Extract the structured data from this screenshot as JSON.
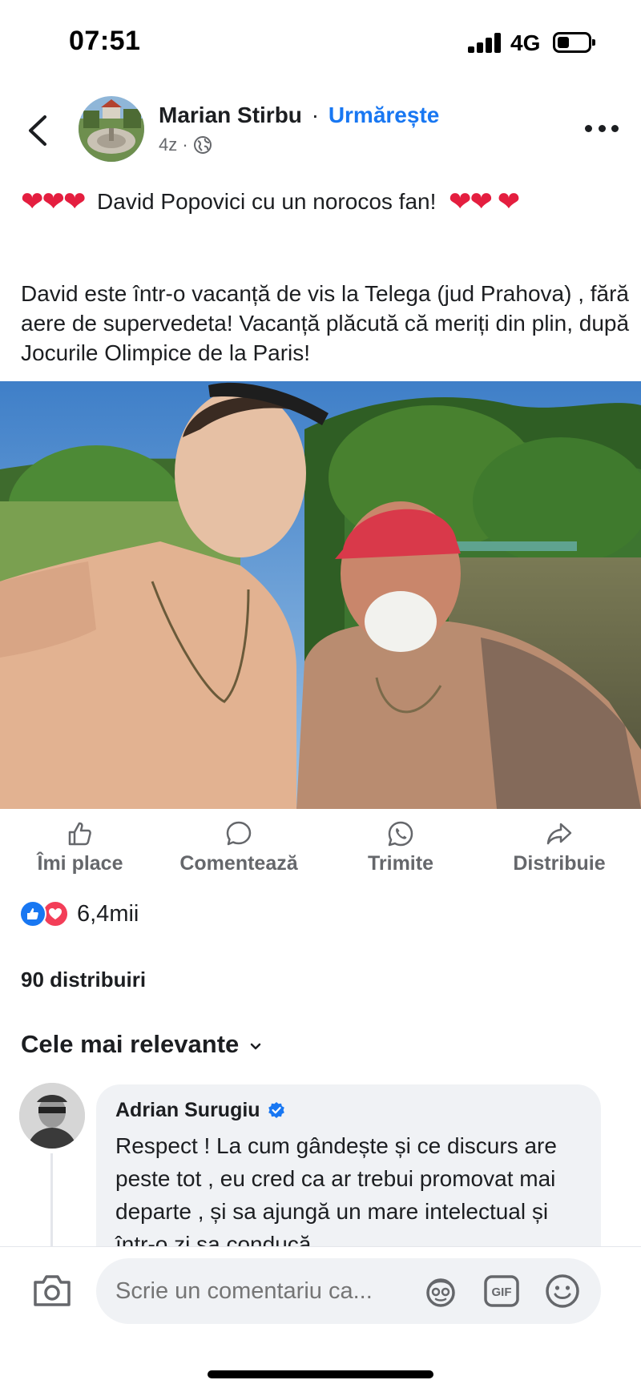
{
  "status_bar": {
    "time": "07:51",
    "network": "4G",
    "battery_level": 0.25
  },
  "post": {
    "author": "Marian Stirbu",
    "separator": "·",
    "follow_label": "Urmărește",
    "time_ago": "4z ·",
    "audience_icon": "globe-icon",
    "headline": "David Popovici cu un norocos fan!",
    "body": "David este într-o  vacanță de vis la Telega (jud Prahova) , fără aere de supervedeta! Vacanță plăcută că meriți din plin,  după Jocurile Olimpice de la Paris!"
  },
  "actions": {
    "like": "Îmi place",
    "comment": "Comentează",
    "send": "Trimite",
    "share": "Distribuie"
  },
  "stats": {
    "reactions_count": "6,4mii",
    "shares": "90 distribuiri"
  },
  "comments": {
    "sort_label": "Cele mai relevante",
    "items": [
      {
        "author": "Adrian Surugiu",
        "verified": true,
        "text": "Respect  ! La cum gândește  și ce discurs are peste tot , eu cred ca ar trebui promovat mai departe , și sa ajungă  un mare intelectual și într-o zi  sa conducă"
      }
    ]
  },
  "composer": {
    "placeholder": "Scrie un comentariu ca..."
  },
  "colors": {
    "accent": "#1877f2",
    "love": "#f33e58",
    "heart": "#e41e3f",
    "muted": "#65676b",
    "bubble": "#f0f2f5"
  }
}
